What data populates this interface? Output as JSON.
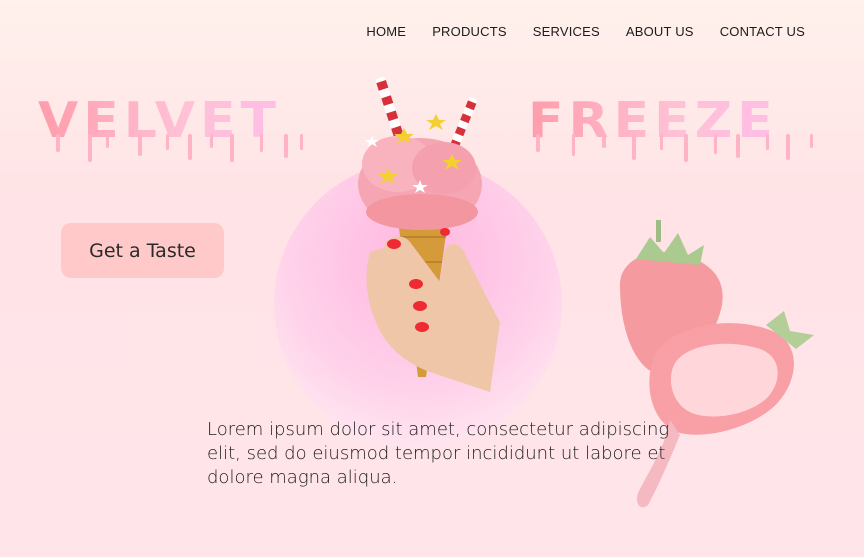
{
  "nav": {
    "items": [
      "HOME",
      "PRODUCTS",
      "SERVICES",
      "ABOUT US",
      "CONTACT US"
    ]
  },
  "hero": {
    "title_left": "VELVET",
    "title_right": "FREEZE",
    "cta_label": "Get a Taste",
    "description": "Lorem ipsum dolor sit amet, consectetur adipiscing elit, sed do eiusmod tempor incididunt ut labore et dolore magna aliqua."
  },
  "colors": {
    "background": "#ffe4ea",
    "title": "#ffb3c0",
    "cta_bg": "#ffc9c9",
    "circle": "#ffc3e2"
  },
  "icons": {
    "hero": "ice-cream-cone-icon",
    "decor": "strawberry-icon"
  }
}
